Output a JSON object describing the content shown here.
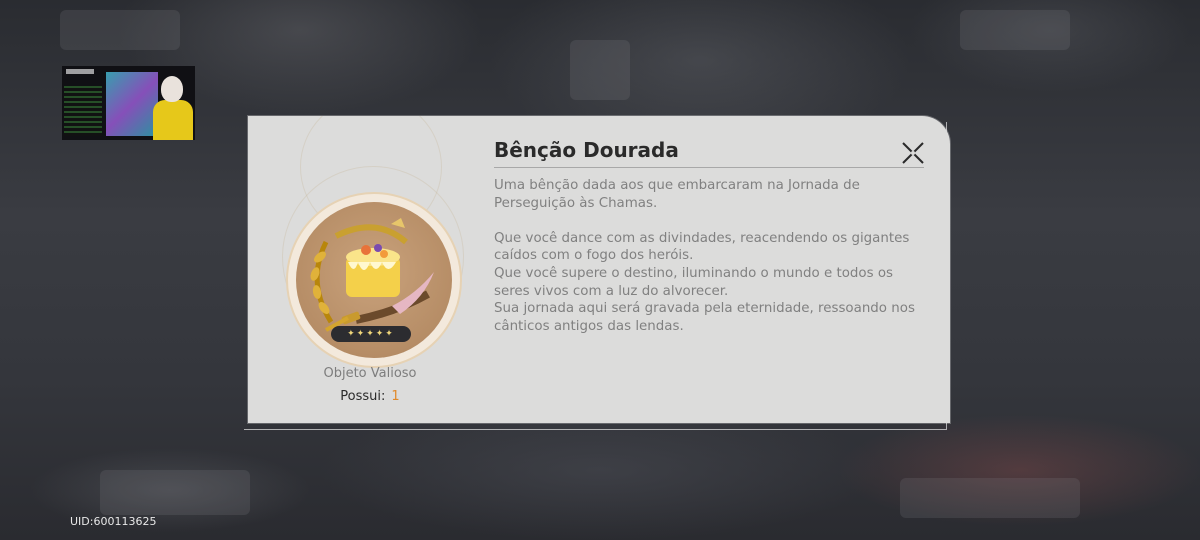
{
  "stream_overlay": {
    "label": "streamer webcam overlay"
  },
  "dialog": {
    "title": "Bênção Dourada",
    "description": "Uma bênção dada aos que embarcaram na Jornada de\nPerseguição às Chamas.\n\nQue você dance com as divindades, reacendendo os gigantes\ncaídos com o fogo dos heróis.\nQue você supere o destino, iluminando o mundo e todos os\nseres vivos com a luz do alvorecer.\nSua jornada aqui será gravada pela eternidade, ressoando nos\ncânticos antigos das lendas.",
    "item_category": "Objeto Valioso",
    "owned_label": "Possui:",
    "owned_count": "1",
    "rarity_stars": "✦✦✦✦✦",
    "close_icon": "close-x-icon"
  },
  "footer": {
    "uid": "UID:600113625"
  },
  "colors": {
    "accent_count": "#e08a2b",
    "dialog_bg": "#dcdcdb",
    "star_color": "#f1d77b"
  }
}
